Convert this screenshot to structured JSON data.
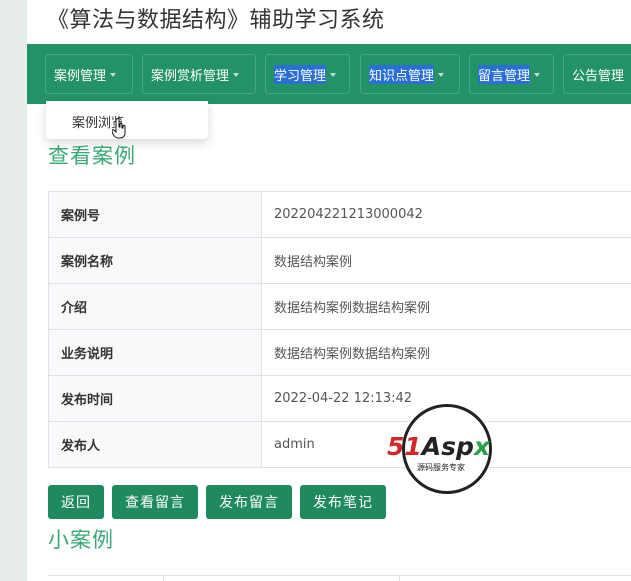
{
  "app": {
    "title": "《算法与数据结构》辅助学习系统"
  },
  "nav": {
    "items": [
      {
        "label": "案例管理",
        "highlight": false
      },
      {
        "label": "案例赏析管理",
        "highlight": true
      },
      {
        "label": "学习管理",
        "highlight": true
      },
      {
        "label": "知识点管理",
        "highlight": true
      },
      {
        "label": "留言管理",
        "highlight": true
      },
      {
        "label": "公告管理",
        "highlight": false
      }
    ],
    "dropdown": {
      "item": "案例浏览"
    }
  },
  "detail": {
    "title": "查看案例",
    "rows": [
      {
        "key": "案例号",
        "value": "202204221213000042"
      },
      {
        "key": "案例名称",
        "value": "数据结构案例"
      },
      {
        "key": "介绍",
        "value": "数据结构案例数据结构案例"
      },
      {
        "key": "业务说明",
        "value": "数据结构案例数据结构案例"
      },
      {
        "key": "发布时间",
        "value": "2022-04-22 12:13:42"
      },
      {
        "key": "发布人",
        "value": "admin"
      }
    ]
  },
  "buttons": {
    "back": "返回",
    "view_messages": "查看留言",
    "post_message": "发布留言",
    "post_note": "发布笔记"
  },
  "sub_section": {
    "title": "小案例"
  },
  "watermark": {
    "logo": "51Aspx",
    "subtitle": "源码服务专家"
  },
  "colors": {
    "nav_bg": "#239266",
    "accent_green": "#3aa877",
    "button_bg": "#1f8a5e",
    "highlight": "#2a6fd6"
  }
}
